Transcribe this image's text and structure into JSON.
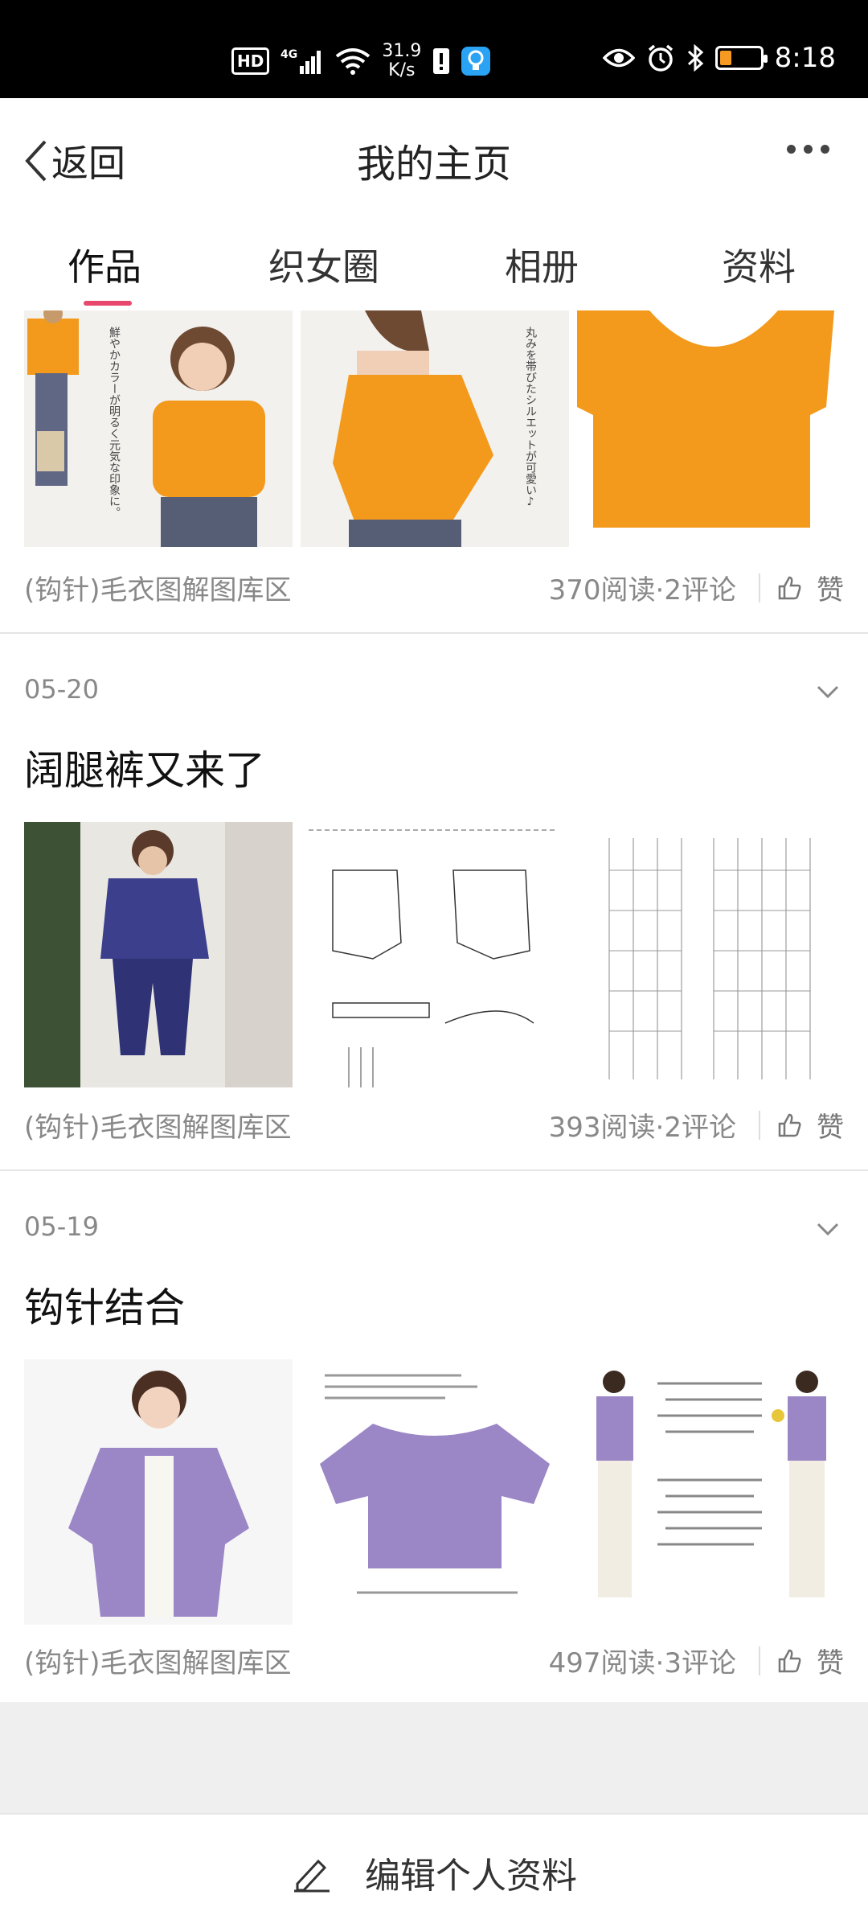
{
  "status_bar": {
    "hd": "HD",
    "network": "4G",
    "speed_value": "31.9",
    "speed_unit": "K/s",
    "time": "8:18",
    "battery_level": 0.3,
    "icons": [
      "hd-icon",
      "signal-4g-icon",
      "wifi-icon",
      "net-speed-icon",
      "sim-alert-icon",
      "lightbulb-icon",
      "eye-icon",
      "alarm-icon",
      "bluetooth-icon",
      "battery-icon"
    ]
  },
  "header": {
    "back_label": "返回",
    "title": "我的主页"
  },
  "tabs": [
    {
      "label": "作品",
      "active": true
    },
    {
      "label": "织女圈",
      "active": false
    },
    {
      "label": "相册",
      "active": false
    },
    {
      "label": "资料",
      "active": false
    }
  ],
  "posts": [
    {
      "date": "",
      "title": "",
      "images": [
        "orange-sweater-model-photo",
        "orange-sweater-side-view",
        "orange-sweater-detail"
      ],
      "source": "(钩针)毛衣图解图库区",
      "stats": "370阅读·2评论",
      "like_label": "赞"
    },
    {
      "date": "05-20",
      "title": "阔腿裤又来了",
      "images": [
        "purple-pants-model-photo",
        "pants-pattern-diagram",
        "pants-stitch-chart"
      ],
      "source": "(钩针)毛衣图解图库区",
      "stats": "393阅读·2评论",
      "like_label": "赞"
    },
    {
      "date": "05-19",
      "title": "钩针结合",
      "images": [
        "purple-cardigan-model-photo",
        "purple-cardigan-flat",
        "purple-cardigan-outfit-page"
      ],
      "source": "(钩针)毛衣图解图库区",
      "stats": "497阅读·3评论",
      "like_label": "赞"
    }
  ],
  "bottom": {
    "edit_label": "编辑个人资料"
  },
  "colors": {
    "accent": "#e8486d",
    "orange": "#f39a1c",
    "purple": "#9b86c6",
    "navy": "#3b3f8c"
  }
}
